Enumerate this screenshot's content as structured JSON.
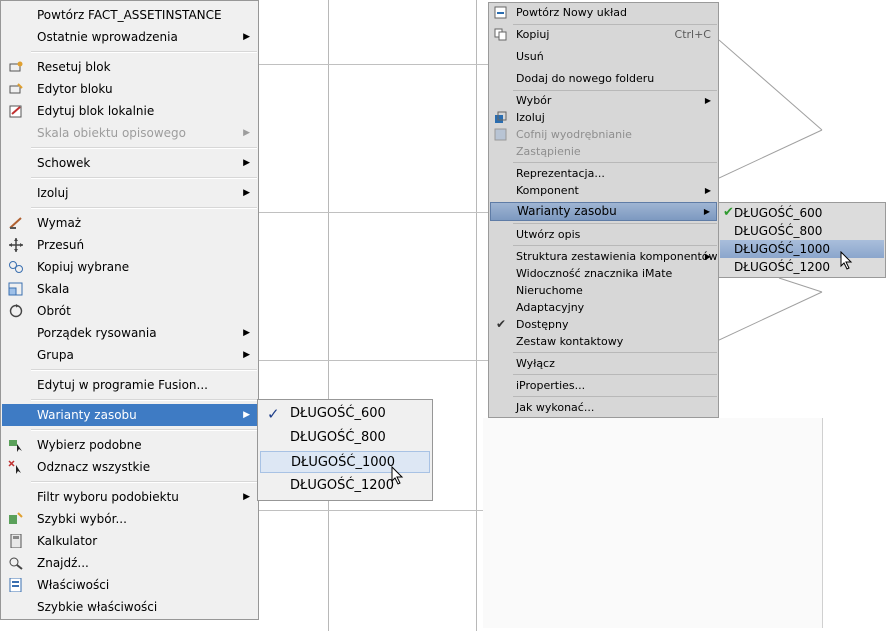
{
  "acad_menu": {
    "items": [
      {
        "label": "Powtórz FACT_ASSETINSTANCE",
        "submenu": false,
        "disabled": false,
        "icon": null
      },
      {
        "label": "Ostatnie wprowadzenia",
        "submenu": true,
        "disabled": false,
        "icon": null
      },
      {
        "label": "Resetuj blok",
        "submenu": false,
        "disabled": false,
        "icon": "block-reset-icon"
      },
      {
        "label": "Edytor bloku",
        "submenu": false,
        "disabled": false,
        "icon": "block-editor-icon"
      },
      {
        "label": "Edytuj blok lokalnie",
        "submenu": false,
        "disabled": false,
        "icon": "refedit-icon"
      },
      {
        "label": "Skala obiektu opisowego",
        "submenu": true,
        "disabled": true,
        "icon": null
      },
      {
        "label": "Schowek",
        "submenu": true,
        "disabled": false,
        "icon": null
      },
      {
        "label": "Izoluj",
        "submenu": true,
        "disabled": false,
        "icon": null
      },
      {
        "label": "Wymaż",
        "submenu": false,
        "disabled": false,
        "icon": "erase-icon"
      },
      {
        "label": "Przesuń",
        "submenu": false,
        "disabled": false,
        "icon": "move-icon"
      },
      {
        "label": "Kopiuj wybrane",
        "submenu": false,
        "disabled": false,
        "icon": "copy-icon"
      },
      {
        "label": "Skala",
        "submenu": false,
        "disabled": false,
        "icon": "scale-icon"
      },
      {
        "label": "Obrót",
        "submenu": false,
        "disabled": false,
        "icon": "rotate-icon"
      },
      {
        "label": "Porządek rysowania",
        "submenu": true,
        "disabled": false,
        "icon": null
      },
      {
        "label": "Grupa",
        "submenu": true,
        "disabled": false,
        "icon": null
      },
      {
        "label": "Edytuj w programie Fusion...",
        "submenu": false,
        "disabled": false,
        "icon": null
      },
      {
        "label": "Warianty zasobu",
        "submenu": true,
        "disabled": false,
        "icon": null,
        "highlighted": true
      },
      {
        "label": "Wybierz podobne",
        "submenu": false,
        "disabled": false,
        "icon": "select-similar-icon"
      },
      {
        "label": "Odznacz wszystkie",
        "submenu": false,
        "disabled": false,
        "icon": "deselect-all-icon"
      },
      {
        "label": "Filtr wyboru podobiektu",
        "submenu": true,
        "disabled": false,
        "icon": null
      },
      {
        "label": "Szybki wybór...",
        "submenu": false,
        "disabled": false,
        "icon": "quick-select-icon"
      },
      {
        "label": "Kalkulator",
        "submenu": false,
        "disabled": false,
        "icon": "calculator-icon"
      },
      {
        "label": "Znajdź...",
        "submenu": false,
        "disabled": false,
        "icon": "find-icon"
      },
      {
        "label": "Właściwości",
        "submenu": false,
        "disabled": false,
        "icon": "properties-icon"
      },
      {
        "label": "Szybkie właściwości",
        "submenu": false,
        "disabled": false,
        "icon": null
      }
    ]
  },
  "acad_submenu": {
    "items": [
      {
        "label": "DŁUGOŚĆ_600",
        "checked": true
      },
      {
        "label": "DŁUGOŚĆ_800",
        "checked": false
      },
      {
        "label": "DŁUGOŚĆ_1000",
        "checked": false,
        "hovered": true
      },
      {
        "label": "DŁUGOŚĆ_1200",
        "checked": false
      }
    ]
  },
  "inv_menu": {
    "items": [
      {
        "label": "Powtórz Nowy układ",
        "icon": "repeat-icon"
      },
      {
        "label": "Kopiuj",
        "shortcut": "Ctrl+C",
        "icon": "copy-icon"
      },
      {
        "label": "Usuń"
      },
      {
        "label": "Dodaj do nowego folderu"
      },
      {
        "label": "Wybór",
        "submenu": true
      },
      {
        "label": "Izoluj",
        "icon": "isolate-icon"
      },
      {
        "label": "Cofnij wyodrębnianie",
        "disabled": true,
        "icon": "undo-isolate-icon"
      },
      {
        "label": "Zastąpienie",
        "disabled": true
      },
      {
        "label": "Reprezentacja..."
      },
      {
        "label": "Komponent",
        "submenu": true
      },
      {
        "label": "Warianty zasobu",
        "submenu": true,
        "highlighted": true
      },
      {
        "label": "Utwórz opis"
      },
      {
        "label": "Struktura zestawienia komponentów",
        "submenu": true
      },
      {
        "label": "Widoczność znacznika iMate"
      },
      {
        "label": "Nieruchome"
      },
      {
        "label": "Adaptacyjny"
      },
      {
        "label": "Dostępny",
        "checked": true
      },
      {
        "label": "Zestaw kontaktowy"
      },
      {
        "label": "Wyłącz"
      },
      {
        "label": "iProperties..."
      },
      {
        "label": "Jak wykonać..."
      }
    ]
  },
  "inv_submenu": {
    "items": [
      {
        "label": "DŁUGOŚĆ_600",
        "checked": true
      },
      {
        "label": "DŁUGOŚĆ_800",
        "checked": false
      },
      {
        "label": "DŁUGOŚĆ_1000",
        "checked": false,
        "hovered": true
      },
      {
        "label": "DŁUGOŚĆ_1200",
        "checked": false
      }
    ]
  },
  "colors": {
    "acad_highlight": "#3e7bc4",
    "inv_menu_bg": "#d7d7d7",
    "inv_check": "#2e9a2e",
    "acad_check": "#1f3f8a"
  }
}
